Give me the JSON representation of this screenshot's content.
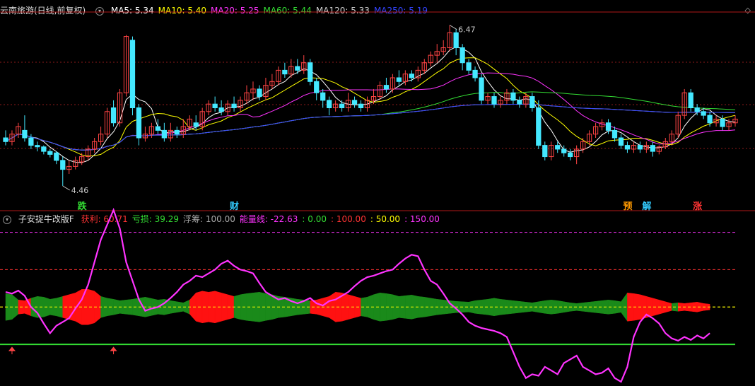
{
  "upper": {
    "title": "云南旅游(日线,前复权)",
    "ma_labels": [
      {
        "text": "MA5: 5.34",
        "color": "#ffffff"
      },
      {
        "text": "MA10: 5.40",
        "color": "#ffff00"
      },
      {
        "text": "MA20: 5.25",
        "color": "#ff33ff"
      },
      {
        "text": "MA60: 5.44",
        "color": "#33dd33"
      },
      {
        "text": "MA120: 5.33",
        "color": "#cccccc"
      },
      {
        "text": "MA250: 5.19",
        "color": "#3344ff"
      }
    ],
    "high_label": "6.47",
    "low_label": "4.46",
    "signals": [
      {
        "text": "跌",
        "x_index": 12,
        "color": "#33dd33"
      },
      {
        "text": "财",
        "x_index": 36,
        "color": "#33ccff"
      },
      {
        "text": "预",
        "x_index": 98,
        "color": "#ff9900"
      },
      {
        "text": "解",
        "x_index": 101,
        "color": "#33ccff"
      },
      {
        "text": "涨",
        "x_index": 109,
        "color": "#ff3333"
      }
    ],
    "icons": [
      "chevron-up-icon",
      "chevron-down-icon"
    ]
  },
  "lower": {
    "title": "子安捉牛改版F",
    "labels": [
      {
        "text": "获利: 60.71",
        "color": "#ff3333"
      },
      {
        "text": "亏损: 39.29",
        "color": "#33dd33"
      },
      {
        "text": "浮筹: 100.00",
        "color": "#aaaaaa"
      },
      {
        "text": "能量线: -22.63",
        "color": "#ff33ff"
      },
      {
        "text": ": 0.00",
        "color": "#33dd33"
      },
      {
        "text": ": 100.00",
        "color": "#ff3333"
      },
      {
        "text": ": 50.00",
        "color": "#ffff00"
      },
      {
        "text": ": 150.00",
        "color": "#ff33ff"
      }
    ]
  },
  "colors": {
    "up": "#ff4444",
    "down": "#44e8ff",
    "grid": "#8b1a1a"
  },
  "chart_data": {
    "type": "candlestick",
    "y_range_upper": [
      4.3,
      6.7
    ],
    "candles": [
      [
        5.1,
        5.05,
        5.2,
        5.0
      ],
      [
        5.05,
        5.15,
        5.2,
        5.0
      ],
      [
        5.15,
        5.25,
        5.3,
        5.1
      ],
      [
        5.2,
        5.1,
        5.4,
        5.05
      ],
      [
        5.1,
        5.0,
        5.15,
        4.95
      ],
      [
        5.0,
        4.98,
        5.05,
        4.92
      ],
      [
        4.98,
        4.92,
        5.0,
        4.88
      ],
      [
        4.92,
        4.88,
        4.95,
        4.84
      ],
      [
        4.9,
        4.8,
        4.92,
        4.75
      ],
      [
        4.8,
        4.68,
        4.85,
        4.46
      ],
      [
        4.68,
        4.72,
        4.8,
        4.62
      ],
      [
        4.72,
        4.8,
        4.85,
        4.68
      ],
      [
        4.78,
        4.85,
        4.9,
        4.74
      ],
      [
        4.85,
        4.95,
        5.0,
        4.8
      ],
      [
        4.95,
        5.05,
        5.1,
        4.9
      ],
      [
        5.05,
        5.15,
        5.25,
        5.0
      ],
      [
        5.15,
        5.45,
        5.5,
        5.1
      ],
      [
        5.5,
        5.3,
        5.6,
        5.25
      ],
      [
        5.3,
        5.7,
        5.75,
        5.25
      ],
      [
        5.7,
        6.45,
        6.47,
        5.65
      ],
      [
        6.4,
        5.5,
        6.45,
        5.4
      ],
      [
        5.5,
        5.1,
        5.55,
        5.0
      ],
      [
        5.1,
        5.15,
        5.25,
        5.05
      ],
      [
        5.15,
        5.25,
        5.3,
        5.1
      ],
      [
        5.25,
        5.2,
        5.35,
        5.15
      ],
      [
        5.2,
        5.1,
        5.3,
        5.05
      ],
      [
        5.1,
        5.2,
        5.3,
        5.05
      ],
      [
        5.2,
        5.15,
        5.25,
        5.1
      ],
      [
        5.15,
        5.25,
        5.35,
        5.1
      ],
      [
        5.25,
        5.35,
        5.4,
        5.2
      ],
      [
        5.3,
        5.25,
        5.4,
        5.2
      ],
      [
        5.25,
        5.45,
        5.5,
        5.2
      ],
      [
        5.45,
        5.55,
        5.6,
        5.4
      ],
      [
        5.55,
        5.5,
        5.65,
        5.45
      ],
      [
        5.5,
        5.45,
        5.6,
        5.4
      ],
      [
        5.45,
        5.55,
        5.6,
        5.4
      ],
      [
        5.55,
        5.5,
        5.65,
        5.45
      ],
      [
        5.5,
        5.6,
        5.65,
        5.45
      ],
      [
        5.6,
        5.7,
        5.8,
        5.55
      ],
      [
        5.7,
        5.75,
        5.85,
        5.6
      ],
      [
        5.75,
        5.65,
        5.8,
        5.6
      ],
      [
        5.65,
        5.8,
        5.9,
        5.6
      ],
      [
        5.8,
        5.85,
        5.95,
        5.75
      ],
      [
        5.85,
        6.0,
        6.05,
        5.8
      ],
      [
        6.0,
        5.95,
        6.1,
        5.9
      ],
      [
        5.95,
        6.05,
        6.15,
        5.9
      ],
      [
        6.05,
        6.0,
        6.15,
        5.95
      ],
      [
        6.0,
        6.1,
        6.2,
        5.95
      ],
      [
        6.1,
        5.85,
        6.15,
        5.8
      ],
      [
        5.85,
        5.7,
        5.9,
        5.6
      ],
      [
        5.7,
        5.6,
        5.75,
        5.5
      ],
      [
        5.6,
        5.5,
        5.65,
        5.4
      ],
      [
        5.5,
        5.55,
        5.6,
        5.45
      ],
      [
        5.55,
        5.5,
        5.6,
        5.45
      ],
      [
        5.5,
        5.6,
        5.7,
        5.45
      ],
      [
        5.6,
        5.55,
        5.65,
        5.5
      ],
      [
        5.55,
        5.5,
        5.6,
        5.45
      ],
      [
        5.5,
        5.6,
        5.65,
        5.45
      ],
      [
        5.6,
        5.65,
        5.75,
        5.55
      ],
      [
        5.65,
        5.8,
        5.85,
        5.6
      ],
      [
        5.8,
        5.75,
        5.9,
        5.7
      ],
      [
        5.75,
        5.9,
        5.95,
        5.7
      ],
      [
        5.9,
        5.85,
        6.0,
        5.8
      ],
      [
        5.85,
        5.95,
        6.0,
        5.8
      ],
      [
        5.95,
        5.9,
        6.0,
        5.85
      ],
      [
        5.9,
        6.0,
        6.05,
        5.85
      ],
      [
        6.0,
        6.1,
        6.15,
        5.95
      ],
      [
        6.1,
        6.2,
        6.25,
        6.05
      ],
      [
        6.2,
        6.25,
        6.35,
        6.1
      ],
      [
        6.25,
        6.3,
        6.4,
        6.2
      ],
      [
        6.3,
        6.5,
        6.6,
        6.25
      ],
      [
        6.5,
        6.3,
        6.55,
        6.2
      ],
      [
        6.3,
        6.1,
        6.35,
        6.0
      ],
      [
        6.1,
        6.0,
        6.15,
        5.95
      ],
      [
        6.0,
        5.9,
        6.05,
        5.85
      ],
      [
        5.9,
        5.6,
        5.95,
        5.55
      ],
      [
        5.6,
        5.65,
        5.7,
        5.55
      ],
      [
        5.65,
        5.55,
        5.7,
        5.5
      ],
      [
        5.55,
        5.6,
        5.65,
        5.5
      ],
      [
        5.6,
        5.7,
        5.75,
        5.55
      ],
      [
        5.7,
        5.6,
        5.75,
        5.55
      ],
      [
        5.6,
        5.55,
        5.65,
        5.5
      ],
      [
        5.55,
        5.65,
        5.7,
        5.5
      ],
      [
        5.65,
        5.5,
        5.7,
        5.45
      ],
      [
        5.5,
        5.0,
        5.6,
        4.95
      ],
      [
        5.0,
        4.85,
        5.05,
        4.8
      ],
      [
        4.85,
        5.0,
        5.05,
        4.8
      ],
      [
        5.0,
        4.95,
        5.05,
        4.9
      ],
      [
        4.95,
        4.9,
        5.0,
        4.85
      ],
      [
        4.9,
        4.85,
        4.95,
        4.8
      ],
      [
        4.85,
        4.95,
        5.0,
        4.75
      ],
      [
        4.95,
        5.05,
        5.1,
        4.9
      ],
      [
        5.05,
        5.15,
        5.2,
        5.0
      ],
      [
        5.15,
        5.25,
        5.3,
        5.1
      ],
      [
        5.25,
        5.3,
        5.35,
        5.2
      ],
      [
        5.3,
        5.2,
        5.35,
        5.15
      ],
      [
        5.2,
        5.1,
        5.25,
        5.05
      ],
      [
        5.1,
        5.0,
        5.15,
        4.95
      ],
      [
        5.0,
        4.95,
        5.05,
        4.9
      ],
      [
        4.95,
        5.0,
        5.05,
        4.9
      ],
      [
        5.0,
        4.95,
        5.05,
        4.9
      ],
      [
        4.95,
        5.0,
        5.05,
        4.9
      ],
      [
        5.0,
        4.92,
        5.05,
        4.85
      ],
      [
        4.92,
        4.98,
        5.0,
        4.88
      ],
      [
        4.98,
        5.05,
        5.1,
        4.95
      ],
      [
        5.05,
        5.15,
        5.2,
        5.0
      ],
      [
        5.15,
        5.4,
        5.45,
        5.1
      ],
      [
        5.4,
        5.7,
        5.75,
        5.35
      ],
      [
        5.7,
        5.5,
        5.75,
        5.45
      ],
      [
        5.5,
        5.45,
        5.55,
        5.4
      ],
      [
        5.45,
        5.4,
        5.5,
        5.35
      ],
      [
        5.4,
        5.3,
        5.45,
        5.25
      ],
      [
        5.3,
        5.35,
        5.4,
        5.25
      ],
      [
        5.35,
        5.25,
        5.4,
        5.2
      ],
      [
        5.25,
        5.3,
        5.35,
        5.2
      ],
      [
        5.3,
        5.35,
        5.4,
        5.25
      ]
    ],
    "energy_line": [
      70,
      68,
      72,
      65,
      50,
      42,
      28,
      15,
      25,
      30,
      35,
      48,
      60,
      80,
      110,
      140,
      160,
      180,
      155,
      110,
      85,
      60,
      45,
      48,
      50,
      55,
      62,
      70,
      80,
      85,
      92,
      90,
      95,
      100,
      108,
      112,
      105,
      100,
      98,
      95,
      82,
      70,
      65,
      60,
      62,
      58,
      55,
      58,
      62,
      55,
      52,
      58,
      60,
      65,
      70,
      78,
      85,
      90,
      92,
      95,
      98,
      100,
      108,
      115,
      120,
      118,
      100,
      85,
      80,
      68,
      55,
      48,
      40,
      30,
      25,
      22,
      20,
      18,
      15,
      10,
      -10,
      -30,
      -45,
      -40,
      -42,
      -30,
      -35,
      -40,
      -25,
      -20,
      -15,
      -30,
      -35,
      -40,
      -38,
      -32,
      -45,
      -50,
      -30,
      10,
      30,
      40,
      35,
      28,
      15,
      8,
      5,
      10,
      6,
      12,
      8,
      15
    ],
    "profit_band": [
      [
        0,
        38
      ],
      [
        0,
        35
      ],
      [
        1,
        20
      ],
      [
        1,
        18
      ],
      [
        0,
        25
      ],
      [
        0,
        30
      ],
      [
        0,
        28
      ],
      [
        0,
        22
      ],
      [
        0,
        25
      ],
      [
        1,
        30
      ],
      [
        1,
        35
      ],
      [
        1,
        40
      ],
      [
        1,
        50
      ],
      [
        1,
        50
      ],
      [
        1,
        45
      ],
      [
        0,
        30
      ],
      [
        0,
        25
      ],
      [
        0,
        22
      ],
      [
        0,
        18
      ],
      [
        0,
        20
      ],
      [
        0,
        22
      ],
      [
        0,
        25
      ],
      [
        0,
        28
      ],
      [
        0,
        24
      ],
      [
        0,
        20
      ],
      [
        0,
        22
      ],
      [
        0,
        18
      ],
      [
        0,
        15
      ],
      [
        0,
        12
      ],
      [
        1,
        20
      ],
      [
        1,
        40
      ],
      [
        1,
        45
      ],
      [
        1,
        42
      ],
      [
        1,
        45
      ],
      [
        1,
        40
      ],
      [
        1,
        35
      ],
      [
        0,
        30
      ],
      [
        0,
        35
      ],
      [
        0,
        38
      ],
      [
        0,
        40
      ],
      [
        0,
        42
      ],
      [
        0,
        38
      ],
      [
        0,
        35
      ],
      [
        0,
        30
      ],
      [
        0,
        28
      ],
      [
        0,
        25
      ],
      [
        0,
        22
      ],
      [
        0,
        20
      ],
      [
        1,
        18
      ],
      [
        1,
        20
      ],
      [
        1,
        25
      ],
      [
        1,
        30
      ],
      [
        1,
        42
      ],
      [
        1,
        40
      ],
      [
        1,
        35
      ],
      [
        1,
        30
      ],
      [
        0,
        25
      ],
      [
        0,
        28
      ],
      [
        0,
        35
      ],
      [
        0,
        40
      ],
      [
        0,
        38
      ],
      [
        0,
        35
      ],
      [
        0,
        30
      ],
      [
        0,
        32
      ],
      [
        0,
        34
      ],
      [
        0,
        30
      ],
      [
        0,
        28
      ],
      [
        0,
        25
      ],
      [
        0,
        22
      ],
      [
        0,
        20
      ],
      [
        0,
        18
      ],
      [
        0,
        16
      ],
      [
        0,
        15
      ],
      [
        0,
        14
      ],
      [
        0,
        18
      ],
      [
        0,
        20
      ],
      [
        0,
        22
      ],
      [
        0,
        25
      ],
      [
        0,
        22
      ],
      [
        0,
        20
      ],
      [
        0,
        18
      ],
      [
        0,
        16
      ],
      [
        0,
        14
      ],
      [
        0,
        12
      ],
      [
        0,
        15
      ],
      [
        0,
        18
      ],
      [
        0,
        20
      ],
      [
        0,
        18
      ],
      [
        0,
        15
      ],
      [
        0,
        12
      ],
      [
        0,
        10
      ],
      [
        0,
        12
      ],
      [
        0,
        14
      ],
      [
        0,
        16
      ],
      [
        0,
        18
      ],
      [
        0,
        20
      ],
      [
        0,
        18
      ],
      [
        0,
        15
      ],
      [
        1,
        40
      ],
      [
        1,
        38
      ],
      [
        1,
        35
      ],
      [
        1,
        30
      ],
      [
        1,
        25
      ],
      [
        1,
        20
      ],
      [
        1,
        15
      ],
      [
        0,
        10
      ],
      [
        1,
        12
      ],
      [
        1,
        10
      ],
      [
        1,
        12
      ],
      [
        1,
        14
      ],
      [
        1,
        10
      ],
      [
        1,
        8
      ]
    ]
  }
}
